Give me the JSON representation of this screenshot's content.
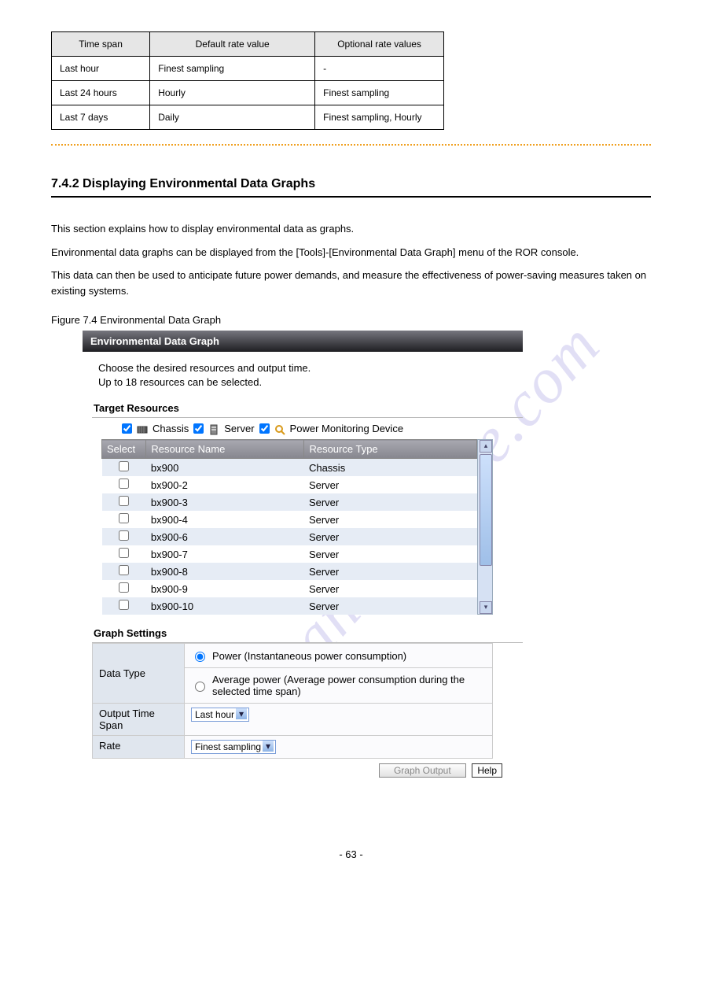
{
  "top_table": {
    "headers": [
      "Time span",
      "Default rate value",
      "Optional rate values"
    ],
    "rows": [
      [
        "Last hour",
        "Finest sampling",
        "-"
      ],
      [
        "Last 24 hours",
        "Hourly",
        "Finest sampling"
      ],
      [
        "Last 7 days",
        "Daily",
        "Finest sampling, Hourly"
      ]
    ]
  },
  "section_title": "7.4.2 Displaying Environmental Data Graphs",
  "para1": "This section explains how to display environmental data as graphs.",
  "para2": "Environmental data graphs can be displayed from the [Tools]-[Environmental Data Graph] menu of the ROR console.",
  "para3": "This data can then be used to anticipate future power demands, and measure the effectiveness of power-saving measures taken on existing systems.",
  "figcap": "Figure 7.4 Environmental Data Graph",
  "env": {
    "header": "Environmental Data Graph",
    "sub1": "Choose the desired resources and output time.",
    "sub2": "Up to 18 resources can be selected.",
    "target_heading": "Target Resources",
    "filters": {
      "chassis": "Chassis",
      "server": "Server",
      "pmd": "Power Monitoring Device"
    },
    "columns": {
      "select": "Select",
      "name": "Resource Name",
      "type": "Resource Type"
    },
    "rows": [
      {
        "name": "bx900",
        "type": "Chassis"
      },
      {
        "name": "bx900-2",
        "type": "Server"
      },
      {
        "name": "bx900-3",
        "type": "Server"
      },
      {
        "name": "bx900-4",
        "type": "Server"
      },
      {
        "name": "bx900-6",
        "type": "Server"
      },
      {
        "name": "bx900-7",
        "type": "Server"
      },
      {
        "name": "bx900-8",
        "type": "Server"
      },
      {
        "name": "bx900-9",
        "type": "Server"
      },
      {
        "name": "bx900-10",
        "type": "Server"
      }
    ],
    "settings_heading": "Graph Settings",
    "settings": {
      "data_type_label": "Data Type",
      "radio_power": "Power (Instantaneous power consumption)",
      "radio_avg": "Average power (Average power consumption during the selected time span)",
      "output_time_label": "Output Time Span",
      "output_time_value": "Last hour",
      "rate_label": "Rate",
      "rate_value": "Finest sampling"
    },
    "buttons": {
      "graph_output": "Graph Output",
      "help": "Help"
    }
  },
  "watermark": "manualshive.com",
  "page_number": "- 63 -"
}
